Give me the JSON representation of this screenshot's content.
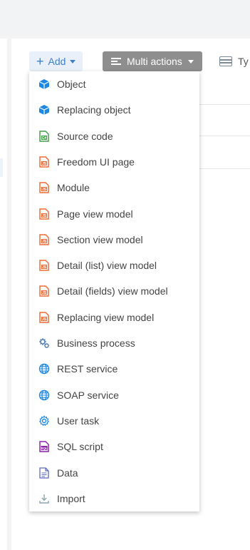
{
  "toolbar": {
    "add_label": "Add",
    "multi_label": "Multi actions",
    "type_label": "Ty"
  },
  "menu": {
    "items": [
      {
        "label": "Object",
        "icon": "cube-icon",
        "color": "#1e88e5"
      },
      {
        "label": "Replacing object",
        "icon": "cube-icon",
        "color": "#1e88e5"
      },
      {
        "label": "Source code",
        "icon": "cs-file-icon",
        "color": "#43a047"
      },
      {
        "label": "Freedom UI page",
        "icon": "js-file-icon",
        "color": "#ef6c35"
      },
      {
        "label": "Module",
        "icon": "js-file-icon",
        "color": "#ef6c35"
      },
      {
        "label": "Page view model",
        "icon": "js-file-icon",
        "color": "#ef6c35"
      },
      {
        "label": "Section view model",
        "icon": "js-file-icon",
        "color": "#ef6c35"
      },
      {
        "label": "Detail (list) view model",
        "icon": "js-file-icon",
        "color": "#ef6c35"
      },
      {
        "label": "Detail (fields) view model",
        "icon": "js-file-icon",
        "color": "#ef6c35"
      },
      {
        "label": "Replacing view model",
        "icon": "js-file-icon",
        "color": "#ef6c35"
      },
      {
        "label": "Business process",
        "icon": "process-icon",
        "color": "#4a7bb7"
      },
      {
        "label": "REST service",
        "icon": "globe-icon",
        "color": "#1e88e5"
      },
      {
        "label": "SOAP service",
        "icon": "globe-icon",
        "color": "#1e88e5"
      },
      {
        "label": "User task",
        "icon": "gear-icon",
        "color": "#1e88e5"
      },
      {
        "label": "SQL script",
        "icon": "sql-file-icon",
        "color": "#8e24aa"
      },
      {
        "label": "Data",
        "icon": "document-icon",
        "color": "#5c6bc0"
      },
      {
        "label": "Import",
        "icon": "import-icon",
        "color": "#90a4ae"
      }
    ]
  }
}
